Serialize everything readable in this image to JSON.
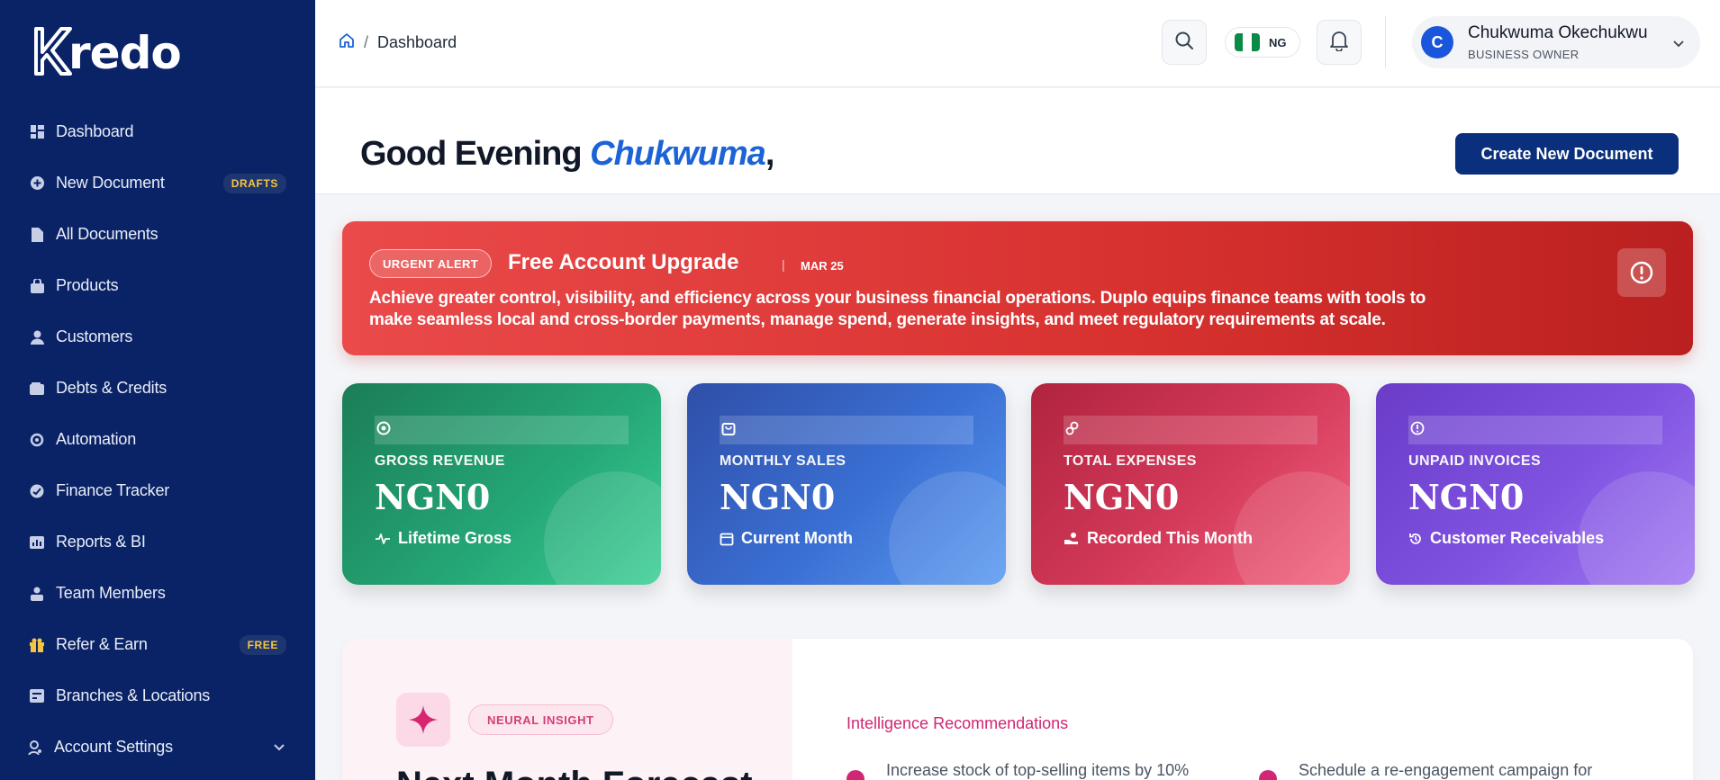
{
  "brand": {
    "name": "kredo",
    "logo_text": "redo"
  },
  "sidebar": {
    "items": [
      {
        "label": "Dashboard",
        "icon": "grid-icon"
      },
      {
        "label": "New Document",
        "icon": "circle-plus-icon",
        "badge": "DRAFTS"
      },
      {
        "label": "All Documents",
        "icon": "file-icon"
      },
      {
        "label": "Products",
        "icon": "bag-icon"
      },
      {
        "label": "Customers",
        "icon": "user-icon"
      },
      {
        "label": "Debts & Credits",
        "icon": "wallet-icon"
      },
      {
        "label": "Automation",
        "icon": "sync-icon"
      },
      {
        "label": "Finance Tracker",
        "icon": "gauge-icon"
      },
      {
        "label": "Reports & BI",
        "icon": "chart-icon"
      },
      {
        "label": "Team Members",
        "icon": "team-icon"
      },
      {
        "label": "Refer & Earn",
        "icon": "gift-icon",
        "badge": "FREE"
      },
      {
        "label": "Branches & Locations",
        "icon": "building-icon"
      },
      {
        "label": "Account Settings",
        "icon": "user-cog-icon"
      }
    ]
  },
  "header": {
    "breadcrumb": "Dashboard",
    "country_code": "NG",
    "user": {
      "initial": "C",
      "name": "Chukwuma Okechukwu",
      "role": "BUSINESS OWNER"
    }
  },
  "greeting": {
    "prefix": "Good Evening",
    "name": "Chukwuma",
    "suffix": ",",
    "cta": "Create New Document"
  },
  "alert": {
    "badge": "URGENT ALERT",
    "title": "Free Account Upgrade",
    "separator": "|",
    "date": "MAR 25",
    "message": "Achieve greater control, visibility, and efficiency across your business financial operations. Duplo equips finance teams with tools to make seamless local and cross-border payments, manage spend, generate insights, and meet regulatory requirements at scale."
  },
  "stats": [
    {
      "label": "GROSS REVENUE",
      "value": "NGN0",
      "sub": "Lifetime Gross",
      "icon": "target-icon",
      "sub_icon": "pulse-icon"
    },
    {
      "label": "MONTHLY SALES",
      "value": "NGN0",
      "sub": "Current Month",
      "icon": "shopping-bag-icon",
      "sub_icon": "calendar-icon"
    },
    {
      "label": "TOTAL EXPENSES",
      "value": "NGN0",
      "sub": "Recorded This Month",
      "icon": "coins-icon",
      "sub_icon": "hand-coins-icon"
    },
    {
      "label": "UNPAID INVOICES",
      "value": "NGN0",
      "sub": "Customer Receivables",
      "icon": "alert-circle-icon",
      "sub_icon": "history-icon"
    }
  ],
  "insight": {
    "tag": "NEURAL INSIGHT",
    "title": "Next Month Forecast",
    "recommendations_title": "Intelligence Recommendations",
    "recommendations": [
      "Increase stock of top-selling items by 10%",
      "Schedule a re-engagement campaign for"
    ]
  },
  "colors": {
    "sidebar_bg": "#0a2366",
    "primary": "#0a2f7d",
    "accent_name": "#1b63d6",
    "alert_red": "#d7312f",
    "card_green": "#1f9a6c",
    "card_blue": "#3a6fd3",
    "card_red": "#cf3350",
    "card_purple": "#7b4fdc",
    "insight_pink": "#d02673"
  }
}
